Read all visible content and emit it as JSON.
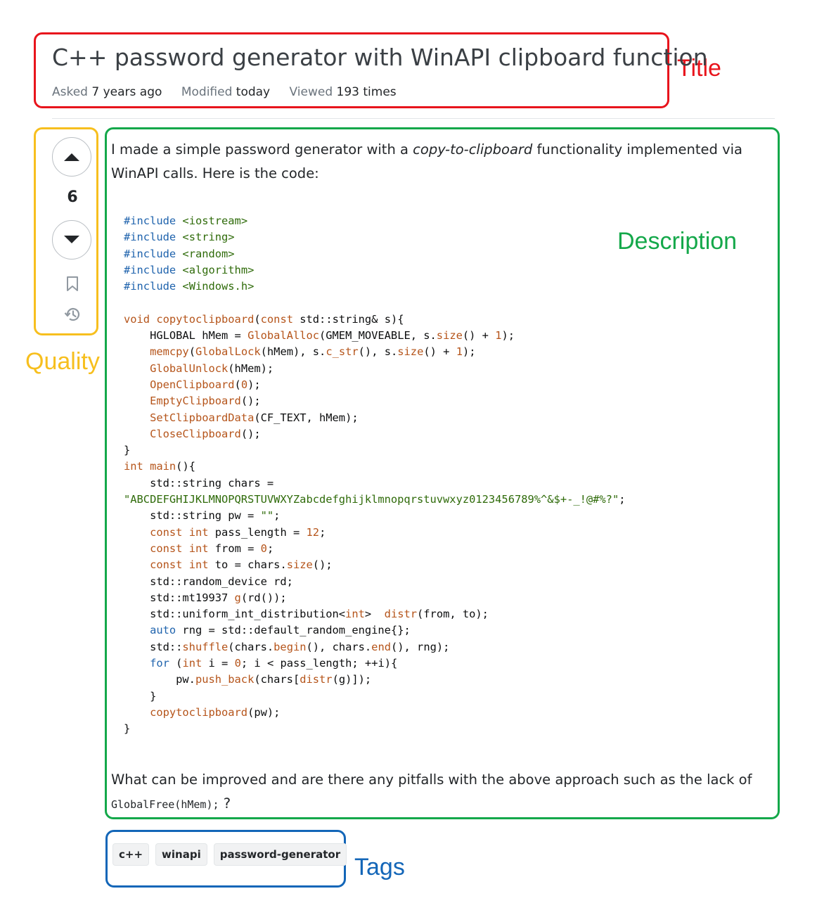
{
  "question": {
    "title": "C++ password generator with WinAPI clipboard function",
    "meta": {
      "asked_label": "Asked",
      "asked_value": "7 years ago",
      "modified_label": "Modified",
      "modified_value": "today",
      "viewed_label": "Viewed",
      "viewed_value": "193 times"
    }
  },
  "votes": {
    "score": "6"
  },
  "body": {
    "intro_1": "I made a simple password generator with a ",
    "intro_em": "copy-to-clipboard",
    "intro_2": " functionality implemented via WinAPI calls. Here is the code:",
    "outro_1": "What can be improved and are there any pitfalls with the above approach such as the lack of ",
    "outro_code": "GlobalFree(hMem);",
    "outro_2": " ?"
  },
  "tags": [
    "c++",
    "winapi",
    "password-generator"
  ],
  "annotations": {
    "title": "Title",
    "quality": "Quality",
    "description": "Description",
    "tags": "Tags"
  },
  "colors": {
    "title_box": "#e8141c",
    "quality_box": "#f7bf1e",
    "description_box": "#14a84a",
    "tags_box": "#1366b8"
  }
}
